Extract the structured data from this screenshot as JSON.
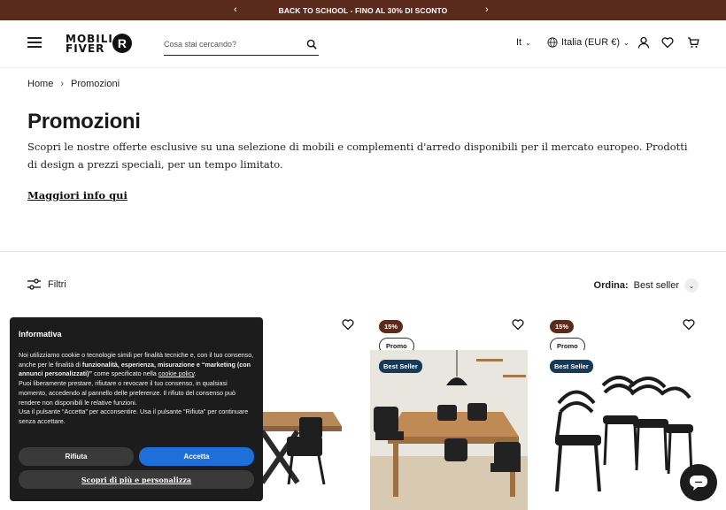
{
  "announcement": {
    "text": "BACK TO SCHOOL - FINO AL 30% DI SCONTO",
    "prev_icon": "chevron-left-icon",
    "next_icon": "chevron-right-icon"
  },
  "header": {
    "logo_text_line1": "MOBILI",
    "logo_text_line2": "FIVER",
    "logo_badge": "R",
    "search_placeholder": "Cosa stai cercando?",
    "language": "It",
    "country": "Italia (EUR €)"
  },
  "breadcrumb": {
    "home": "Home",
    "separator": "›",
    "current": "Promozioni"
  },
  "page": {
    "title": "Promozioni",
    "description": "Scopri le nostre offerte esclusive su una selezione di mobili e complementi d'arredo disponibili per il mercato europeo. Prodotti di design a prezzi speciali, per un tempo limitato.",
    "more_link": "Maggiori info qui"
  },
  "toolbar": {
    "filters_label": "Filtri",
    "sort_label": "Ordina:",
    "sort_value": "Best seller"
  },
  "products": [
    {
      "discount": "",
      "promo": "",
      "best": ""
    },
    {
      "discount": "15%",
      "promo": "Promo",
      "best": "Best Seller"
    },
    {
      "discount": "15%",
      "promo": "Promo",
      "best": "Best Seller"
    }
  ],
  "cookie": {
    "title": "Informativa",
    "p1_a": "Noi utilizziamo cookie o tecnologie simili per finalità tecniche e, con il tuo consenso, anche per le finalità di ",
    "p1_b": "funzionalità, esperienza, misurazione e “marketing (con annunci personalizzati)”",
    "p1_c": " come specificato nella ",
    "p1_link": "cookie policy",
    "p1_d": ".",
    "p2": "Puoi liberamente prestare, rifiutare o revocare il tuo consenso, in qualsiasi momento, accedendo al pannello delle preferenze. Il rifiuto del consenso può rendere non disponibili le relative funzioni.",
    "p3": "Usa il pulsante “Accetta” per acconsentire. Usa il pulsante “Rifiuta” per continuare senza accettare.",
    "refuse": "Rifiuta",
    "accept": "Accetta",
    "customize": "Scopri di più e personalizza"
  },
  "colors": {
    "brand_brown": "#5a2a1c",
    "accept_blue": "#1e6fd9",
    "best_seller_navy": "#163a5a"
  }
}
